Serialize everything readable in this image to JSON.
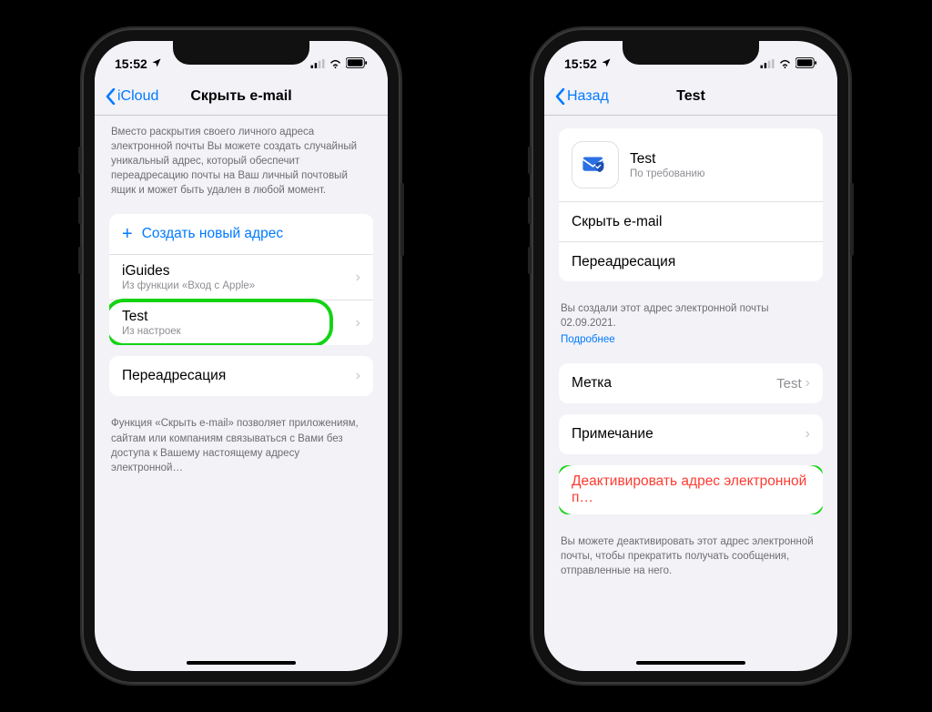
{
  "statusBar": {
    "time": "15:52"
  },
  "left": {
    "nav": {
      "back": "iCloud",
      "title": "Скрыть e-mail"
    },
    "introDesc": "Вместо раскрытия своего личного адреса электронной почты Вы можете создать случайный уникальный адрес, который обеспечит переадресацию почты на Ваш личный почтовый ящик и может быть удален в любой момент.",
    "createLabel": "Создать новый адрес",
    "items": [
      {
        "title": "iGuides",
        "sub": "Из функции «Вход с Apple»"
      },
      {
        "title": "Test",
        "sub": "Из настроек"
      }
    ],
    "forwarding": "Переадресация",
    "footerDesc": "Функция «Скрыть e-mail» позволяет приложениям, сайтам или компаниям связываться с Вами без доступа к Вашему настоящему адресу электронной…"
  },
  "right": {
    "nav": {
      "back": "Назад",
      "title": "Test"
    },
    "header": {
      "title": "Test",
      "sub": "По требованию"
    },
    "rows": {
      "hide": "Скрыть e-mail",
      "forwarding": "Переадресация",
      "label": "Метка",
      "labelValue": "Test",
      "note": "Примечание"
    },
    "createdDesc": "Вы создали этот адрес электронной почты 02.09.2021.",
    "learnMore": "Подробнее",
    "deactivate": "Деактивировать адрес электронной п…",
    "deactivateDesc": "Вы можете деактивировать этот адрес электронной почты, чтобы прекратить получать сообщения, отправленные на него."
  }
}
